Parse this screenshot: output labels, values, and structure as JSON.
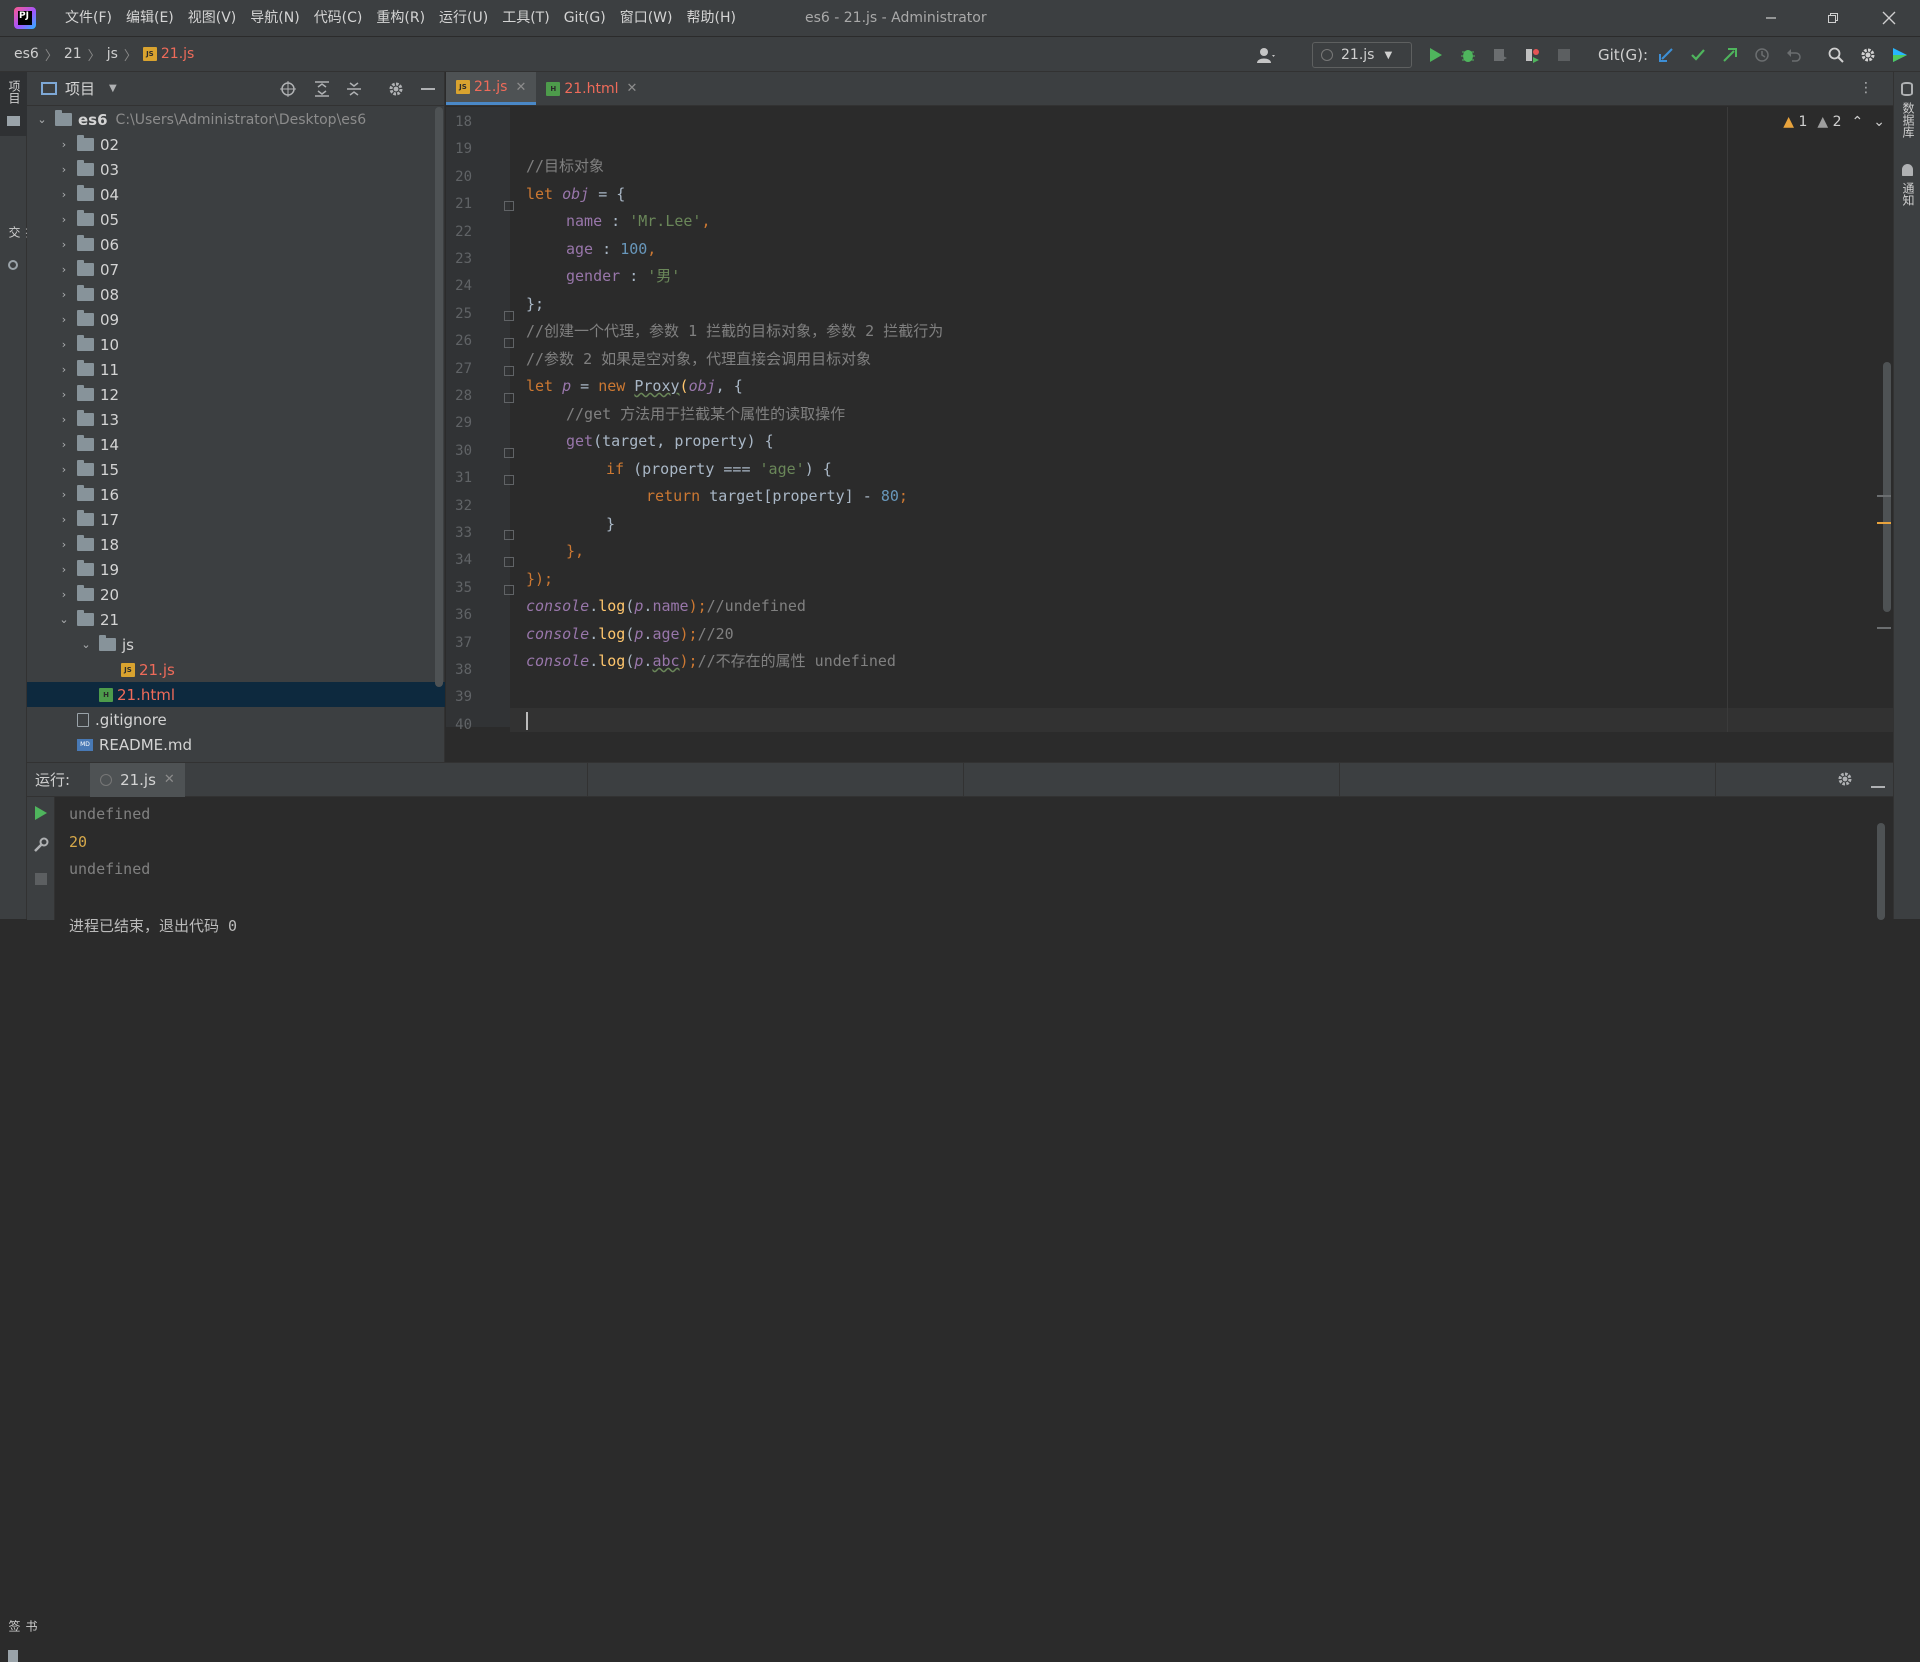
{
  "titlebar": {
    "app_logo": "PJ",
    "menus": [
      "文件(F)",
      "编辑(E)",
      "视图(V)",
      "导航(N)",
      "代码(C)",
      "重构(R)",
      "运行(U)",
      "工具(T)",
      "Git(G)",
      "窗口(W)",
      "帮助(H)"
    ],
    "window_title": "es6 - 21.js - Administrator",
    "controls": [
      "minimize-icon",
      "restore-icon",
      "close-icon"
    ]
  },
  "navbar": {
    "breadcrumbs": [
      "es6",
      "21",
      "js",
      "21.js"
    ],
    "run_config": "21.js",
    "git_label": "Git(G):"
  },
  "left_stripe": {
    "project_label": "项目",
    "commit_label": "提交",
    "bookmarks_label": "书签"
  },
  "right_stripe": {
    "database_label": "数据库",
    "notifications_label": "通知"
  },
  "project": {
    "title": "项目",
    "root_name": "es6",
    "root_path": "C:\\Users\\Administrator\\Desktop\\es6",
    "folders": [
      "02",
      "03",
      "04",
      "05",
      "06",
      "07",
      "08",
      "09",
      "10",
      "11",
      "12",
      "13",
      "14",
      "15",
      "16",
      "17",
      "18",
      "19",
      "20",
      "21"
    ],
    "sub_folder": "js",
    "sub_file": "21.js",
    "html_file": "21.html",
    "gitignore": ".gitignore",
    "readme": "README.md"
  },
  "editor": {
    "tabs": [
      {
        "label": "21.js",
        "active": true
      },
      {
        "label": "21.html",
        "active": false
      }
    ],
    "warnings": "1",
    "weak_warnings": "2",
    "line_numbers": [
      "18",
      "19",
      "20",
      "21",
      "22",
      "23",
      "24",
      "25",
      "26",
      "27",
      "28",
      "29",
      "30",
      "31",
      "32",
      "33",
      "34",
      "35",
      "36",
      "37",
      "38",
      "39",
      "40"
    ],
    "code": {
      "l20": "//目标对象",
      "l21_kw": "let ",
      "l21_var": "obj",
      "l21_rest": " = {",
      "l22_prop": "name",
      "l22_sep": " : ",
      "l22_str": "'Mr.Lee'",
      "l22_end": ",",
      "l23_prop": "age",
      "l23_sep": " : ",
      "l23_num": "100",
      "l23_end": ",",
      "l24_prop": "gender",
      "l24_sep": " : ",
      "l24_str": "'男'",
      "l25": "};",
      "l26": "//创建一个代理，参数 1 拦截的目标对象，参数 2 拦截行为",
      "l27": "//参数 2 如果是空对象，代理直接会调用目标对象",
      "l28_kw": "let ",
      "l28_var": "p",
      "l28_mid": " = ",
      "l28_new": "new ",
      "l28_cls": "Proxy",
      "l28_open": "(",
      "l28_arg": "obj",
      "l28_end": ", {",
      "l29": "//get 方法用于拦截某个属性的读取操作",
      "l30_fn": "get",
      "l30_rest": "(target, property) {",
      "l31_kw": "if ",
      "l31_mid": "(property === ",
      "l31_str": "'age'",
      "l31_end": ") {",
      "l32_kw": "return ",
      "l32_mid": "target[property] - ",
      "l32_num": "80",
      "l32_end": ";",
      "l33": "}",
      "l34": "},",
      "l35": "});",
      "l36_obj": "console",
      "l36_dot": ".",
      "l36_fn": "log",
      "l36_open": "(",
      "l36_var": "p",
      "l36_dot2": ".",
      "l36_prop": "name",
      "l36_close": ");",
      "l36_cmt": "//undefined",
      "l37_obj": "console",
      "l37_dot": ".",
      "l37_fn": "log",
      "l37_open": "(",
      "l37_var": "p",
      "l37_dot2": ".",
      "l37_prop": "age",
      "l37_close": ");",
      "l37_cmt": "//20",
      "l38_obj": "console",
      "l38_dot": ".",
      "l38_fn": "log",
      "l38_open": "(",
      "l38_var": "p",
      "l38_dot2": ".",
      "l38_prop": "abc",
      "l38_close": ");",
      "l38_cmt": "//不存在的属性 undefined"
    }
  },
  "run": {
    "label": "运行:",
    "tab": "21.js",
    "output": [
      "undefined",
      "20",
      "undefined",
      "",
      "进程已结束，退出代码 0"
    ]
  },
  "colors": {
    "bg": "#2b2b2b",
    "panel": "#3c3f41",
    "accent": "#4a88c7",
    "keyword": "#cc7832",
    "string": "#6a8759",
    "number": "#6897bb",
    "comment": "#808080",
    "warning": "#e8a33d"
  }
}
